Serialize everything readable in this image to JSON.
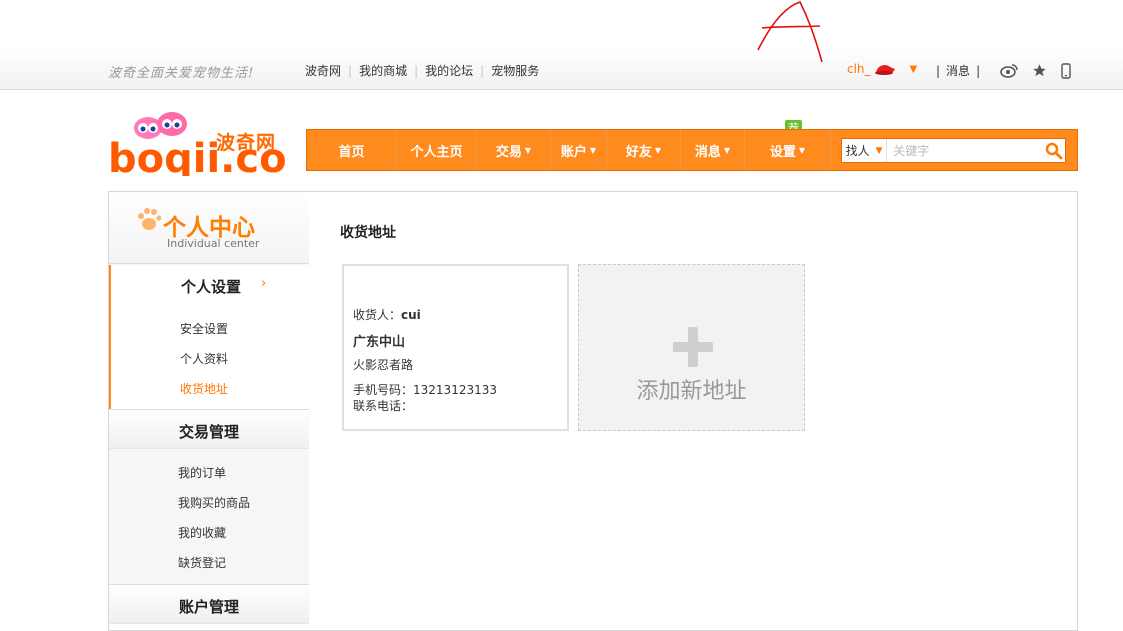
{
  "topbar": {
    "slogan": "波奇全面关爱宠物生活!",
    "links": [
      "波奇网",
      "我的商城",
      "我的论坛",
      "宠物服务"
    ],
    "username": "clh_",
    "messages_label": "消息",
    "scribble": "A"
  },
  "header": {
    "logo_text": "波奇网",
    "logo_mark": "boqii.com",
    "nav": [
      {
        "label": "首页",
        "dropdown": false
      },
      {
        "label": "个人主页",
        "dropdown": false
      },
      {
        "label": "交易",
        "dropdown": true
      },
      {
        "label": "账户",
        "dropdown": true
      },
      {
        "label": "好友",
        "dropdown": true
      },
      {
        "label": "消息",
        "dropdown": true
      },
      {
        "label": "设置",
        "dropdown": true
      }
    ],
    "badge": "荐",
    "search": {
      "type": "找人",
      "placeholder": "关键字"
    }
  },
  "sidebar": {
    "title_cn": "个人中心",
    "title_en": "Individual center",
    "groups": [
      {
        "title": "个人设置",
        "items": [
          "安全设置",
          "个人资料",
          "收货地址"
        ],
        "active_item": "收货地址"
      },
      {
        "title": "交易管理",
        "items": [
          "我的订单",
          "我购买的商品",
          "我的收藏",
          "缺货登记"
        ]
      },
      {
        "title": "账户管理",
        "items": []
      }
    ]
  },
  "content": {
    "title": "收货地址",
    "address": {
      "recipient_label": "收货人：",
      "recipient": "cui",
      "region": "广东中山",
      "street": "火影忍者路",
      "mobile_label": "手机号码：",
      "mobile": "13213123133",
      "phone_label": "联系电话："
    },
    "add_label": "添加新地址"
  },
  "colors": {
    "accent": "#ff8a1e",
    "accent_text": "#ff7800",
    "badge": "#6cbf2e"
  }
}
